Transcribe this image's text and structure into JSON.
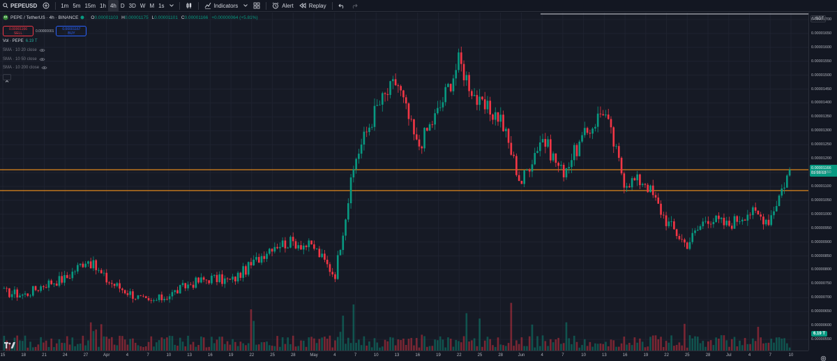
{
  "toolbar": {
    "symbol": "PEPEUSD",
    "timeframes": [
      "1m",
      "5m",
      "15m",
      "1h",
      "4h",
      "D",
      "3D",
      "W",
      "M",
      "1s"
    ],
    "active_timeframe": "4h",
    "indicators_label": "Indicators",
    "alert_label": "Alert",
    "replay_label": "Replay"
  },
  "legend": {
    "title": "PEPE / TetherUS · 4h · BINANCE",
    "open_label": "O",
    "open": "0.00001103",
    "high_label": "H",
    "high": "0.00001175",
    "low_label": "L",
    "low": "0.00001101",
    "close_label": "C",
    "close": "0.00001166",
    "change": "+0.00000064 (+5.81%)"
  },
  "trade": {
    "sell_price": "0.00001166",
    "sell_label": "SELL",
    "spread": "0.00000001",
    "buy_price": "0.00001167",
    "buy_label": "BUY"
  },
  "indicators": [
    {
      "label": "Vol · PEPE",
      "value": "6.19 T"
    },
    {
      "label": "SMA · 10 20 close"
    },
    {
      "label": "SMA · 10 50 close"
    },
    {
      "label": "SMA · 10 200 close"
    }
  ],
  "price_scale": {
    "currency": "USDT",
    "labels": [
      "0.00001700",
      "0.00001650",
      "0.00001600",
      "0.00001550",
      "0.00001500",
      "0.00001450",
      "0.00001400",
      "0.00001350",
      "0.00001300",
      "0.00001250",
      "0.00001200",
      "0.00001150",
      "0.00001100",
      "0.00001050",
      "0.00001000",
      "0.00000950",
      "0.00000900",
      "0.00000850",
      "0.00000800",
      "0.00000750",
      "0.00000700",
      "0.00000650",
      "0.00000600",
      "0.00000550"
    ],
    "current_price": "0.00001166",
    "countdown": "01:56:13",
    "volume_value": "6.19 T"
  },
  "time_axis": {
    "labels": [
      "15",
      "18",
      "21",
      "24",
      "27",
      "Apr",
      "4",
      "7",
      "10",
      "13",
      "16",
      "19",
      "22",
      "25",
      "28",
      "May",
      "4",
      "7",
      "10",
      "13",
      "16",
      "19",
      "22",
      "25",
      "28",
      "Jun",
      "4",
      "7",
      "10",
      "13",
      "16",
      "19",
      "22",
      "25",
      "28",
      "Jul",
      "4",
      "7",
      "10"
    ]
  },
  "chart_data": {
    "type": "line",
    "symbol": "PEPE / TetherUS",
    "interval": "4h",
    "up_color": "#089981",
    "down_color": "#f23645",
    "horizontal_lines": [
      1.73e-05,
      1.16e-05,
      1.085e-05
    ],
    "ylim": [
      5.1e-06,
      1.725e-05
    ],
    "x": [
      "15",
      "18",
      "21",
      "24",
      "27",
      "Apr",
      "4",
      "7",
      "10",
      "13",
      "16",
      "19",
      "22",
      "25",
      "28",
      "May",
      "4",
      "7",
      "10",
      "13",
      "16",
      "19",
      "22",
      "25",
      "28",
      "Jun",
      "4",
      "7",
      "10",
      "13",
      "16",
      "19",
      "22",
      "25",
      "28",
      "Jul",
      "4",
      "7",
      "10"
    ],
    "series": [
      {
        "values": [
          7.2e-06,
          7.1e-06,
          7.5e-06,
          7.7e-06,
          8.4e-06,
          7.6e-06,
          7.2e-06,
          6.8e-06,
          7.1e-06,
          7.5e-06,
          7.7e-06,
          7.6e-06,
          8.2e-06,
          8.9e-06,
          9e-06,
          8.8e-06,
          7.8e-06,
          1.2e-05,
          1.38e-05,
          1.48e-05,
          1.24e-05,
          1.37e-05,
          1.55e-05,
          1.39e-05,
          1.35e-05,
          1.11e-05,
          1.28e-05,
          1.15e-05,
          1.27e-05,
          1.38e-05,
          1.12e-05,
          1.12e-05,
          9.8e-06,
          8.9e-06,
          9.9e-06,
          9.6e-06,
          1.01e-05,
          9.8e-06,
          1.16e-05
        ]
      }
    ]
  }
}
